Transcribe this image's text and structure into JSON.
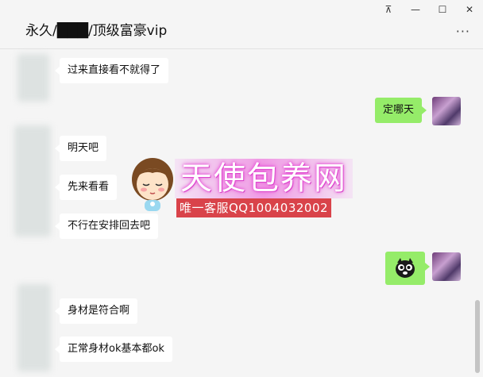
{
  "window": {
    "title": "永久/███/顶级富豪vip",
    "controls": [
      "⊼",
      "—",
      "☐",
      "✕"
    ],
    "more_label": "···"
  },
  "messages": [
    {
      "side": "left",
      "text": "过来直接看不就得了"
    },
    {
      "side": "right",
      "text": "定哪天"
    },
    {
      "side": "left",
      "text": "明天吧"
    },
    {
      "side": "left",
      "text": "先来看看"
    },
    {
      "side": "left",
      "text": "不行在安排回去吧"
    },
    {
      "side": "right",
      "type": "sticker",
      "icon": "owl-sticker-icon"
    },
    {
      "side": "left",
      "text": "身材是符合啊"
    },
    {
      "side": "left",
      "text": "正常身材ok基本都ok"
    }
  ],
  "watermark": {
    "title": "天使包养网",
    "subtitle": "唯一客服QQ1004032002"
  },
  "colors": {
    "bubble_right": "#95ec69",
    "bubble_left": "#ffffff",
    "background": "#f5f5f5"
  }
}
